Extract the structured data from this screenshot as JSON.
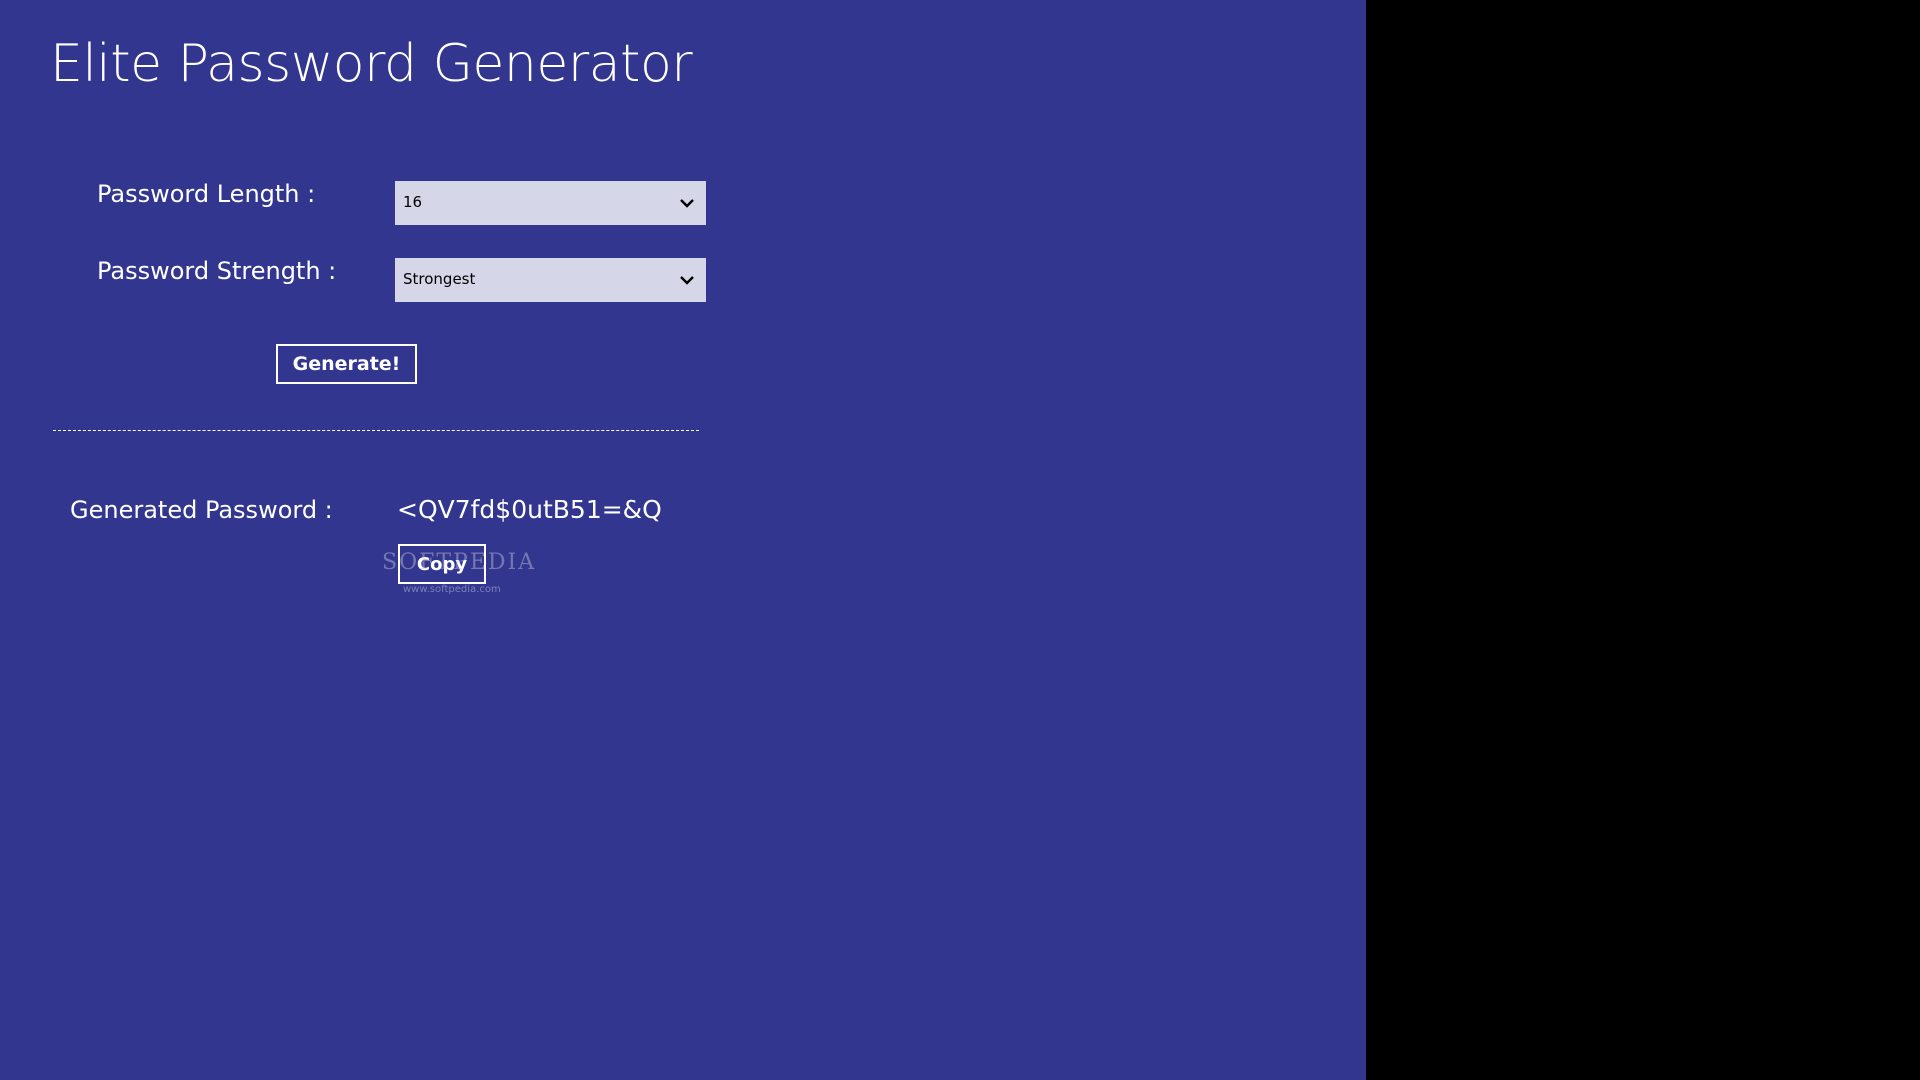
{
  "app": {
    "title": "Elite Password Generator",
    "background_color": "#32368f"
  },
  "form": {
    "length_label": "Password Length :",
    "length_value": "16",
    "strength_label": "Password Strength :",
    "strength_value": "Strongest",
    "generate_label": "Generate!"
  },
  "result": {
    "label": "Generated Password :",
    "password": "<QV7fd$0utB51=&Q",
    "copy_label": "Copy"
  },
  "watermark": {
    "brand": "SOFTPEDIA",
    "url": "www.softpedia.com"
  },
  "icons": {
    "dropdown": "chevron-down-icon"
  }
}
